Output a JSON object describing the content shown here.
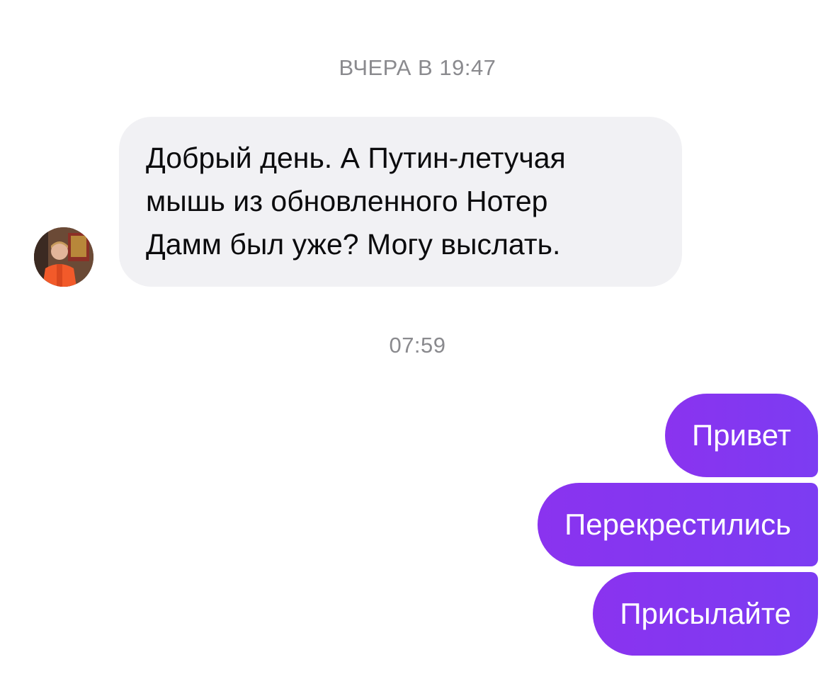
{
  "timestamps": {
    "yesterday": "ВЧЕРА В 19:47",
    "today": "07:59"
  },
  "incoming": {
    "avatar_icon": "user-avatar-photo",
    "lines": [
      "Добрый день. А Путин-летучая",
      "мышь из обновленного Нотер",
      "Дамм был уже? Могу выслать."
    ]
  },
  "outgoing": [
    {
      "text": "Привет"
    },
    {
      "text": "Перекрестились"
    },
    {
      "text": "Присылайте"
    }
  ],
  "colors": {
    "incoming_bubble": "#f1f1f4",
    "outgoing_bubble": "#8a33ef",
    "timestamp": "#8a8a8e"
  }
}
